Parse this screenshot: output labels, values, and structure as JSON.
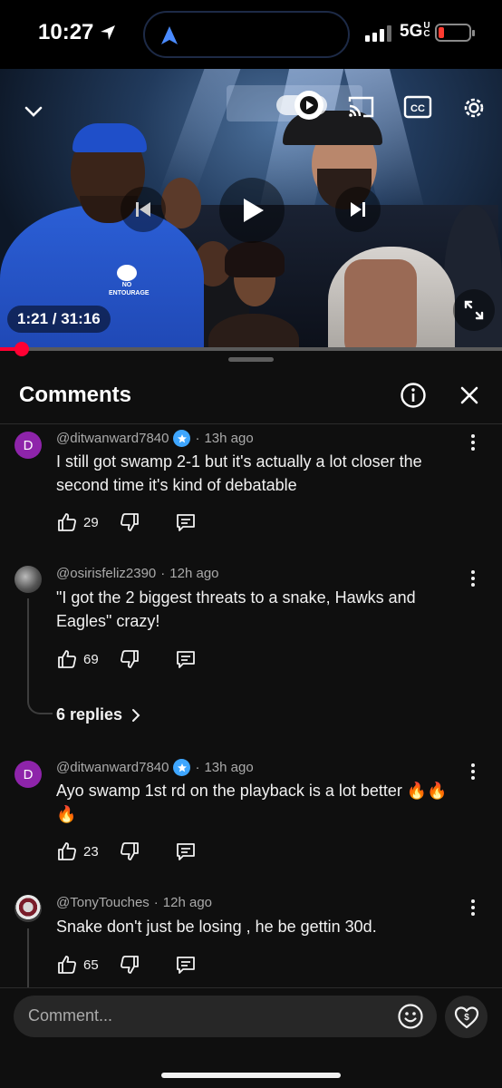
{
  "status_bar": {
    "time": "10:27",
    "network": "5G",
    "network_sub": "UC"
  },
  "video": {
    "timestamp": "1:21 / 31:16",
    "progress": 0.043,
    "sweatshirt_text_1": "NO",
    "sweatshirt_text_2": "ENTOURAGE"
  },
  "comments_panel": {
    "title": "Comments",
    "comments": [
      {
        "avatar_letter": "D",
        "author": "@ditwanward7840",
        "verified": true,
        "time": "13h ago",
        "text": "I still got swamp 2-1 but it's actually a lot closer the second time it's kind of debatable",
        "likes": "29"
      },
      {
        "author": "@osirisfeliz2390",
        "verified": false,
        "time": "12h ago",
        "text": "\"I got the 2 biggest threats to a snake, Hawks and Eagles\" crazy!",
        "likes": "69",
        "replies": "6 replies"
      },
      {
        "avatar_letter": "D",
        "author": "@ditwanward7840",
        "verified": true,
        "time": "13h ago",
        "text": "Ayo swamp 1st rd on the playback is a lot better 🔥🔥🔥",
        "likes": "23"
      },
      {
        "author": "@TonyTouches",
        "verified": false,
        "time": "12h ago",
        "text": "Snake don't just be losing , he be gettin 30d.",
        "likes": "65"
      }
    ]
  },
  "comment_input": {
    "placeholder": "Comment..."
  },
  "colors": {
    "accent": "#ff0033",
    "avatar_purple": "#8e24aa",
    "verified_blue": "#3ea6ff"
  },
  "icons": [
    "location-arrow-icon",
    "chevron-down-icon",
    "autoplay-icon",
    "cast-icon",
    "captions-icon",
    "settings-gear-icon",
    "previous-icon",
    "play-icon",
    "next-icon",
    "fullscreen-icon",
    "info-icon",
    "close-icon",
    "thumbs-up-icon",
    "thumbs-down-icon",
    "reply-icon",
    "more-vert-icon",
    "emoji-icon",
    "super-thanks-icon"
  ]
}
